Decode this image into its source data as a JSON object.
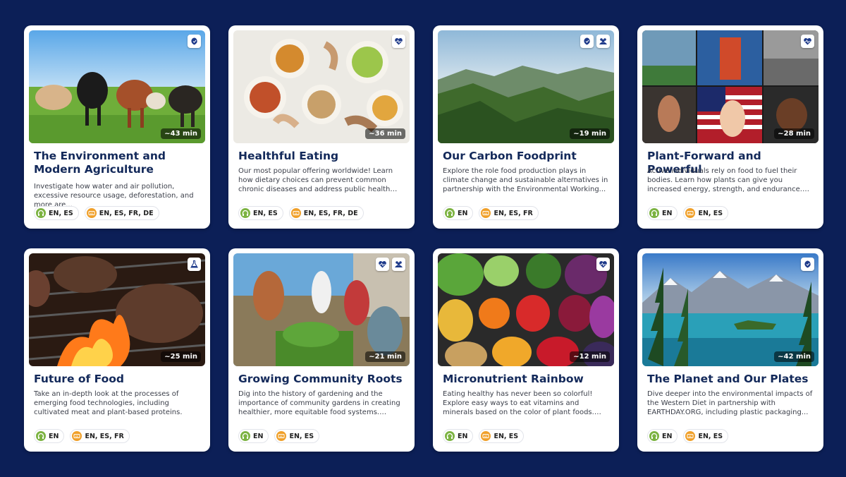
{
  "cards": [
    {
      "title": "The Environment and Modern Agriculture",
      "description": "Investigate how water and air pollution, excessive resource usage, deforestation, and more are...",
      "duration": "~43 min",
      "audio": "EN, ES",
      "cc": "EN, ES, FR, DE",
      "badges": [
        "leaf-heart-icon"
      ]
    },
    {
      "title": "Healthful Eating",
      "description": "Our most popular offering worldwide! Learn how dietary choices can prevent common chronic diseases and address public health concerns...",
      "duration": "~36 min",
      "audio": "EN, ES",
      "cc": "EN, ES, FR, DE",
      "badges": [
        "heart-pulse-icon"
      ]
    },
    {
      "title": "Our Carbon Foodprint",
      "description": "Explore the role food production plays in climate change and sustainable alternatives in partnership with the Environmental Working...",
      "duration": "~19 min",
      "audio": "EN",
      "cc": "EN, ES, FR",
      "badges": [
        "leaf-heart-icon",
        "community-icon"
      ]
    },
    {
      "title": "Plant-Forward and Powerful",
      "description": "Active individuals rely on food to fuel their bodies. Learn how plants can give you increased energy, strength, and endurance. These material...",
      "duration": "~28 min",
      "audio": "EN",
      "cc": "EN, ES",
      "badges": [
        "heart-pulse-icon"
      ]
    },
    {
      "title": "Future of Food",
      "description": "Take an in-depth look at the processes of emerging food technologies, including cultivated meat and plant-based proteins.",
      "duration": "~25 min",
      "audio": "EN",
      "cc": "EN, ES, FR",
      "badges": [
        "flask-icon"
      ]
    },
    {
      "title": "Growing Community Roots",
      "description": "Dig into the history of gardening and the importance of community gardens in creating healthier, more equitable food systems. These...",
      "duration": "~21 min",
      "audio": "EN",
      "cc": "EN, ES",
      "badges": [
        "heart-pulse-icon",
        "community-icon"
      ]
    },
    {
      "title": "Micronutrient Rainbow",
      "description": "Eating healthy has never been so colorful! Explore easy ways to eat vitamins and minerals based on the color of plant foods. These...",
      "duration": "~12 min",
      "audio": "EN",
      "cc": "EN, ES",
      "badges": [
        "heart-pulse-icon"
      ]
    },
    {
      "title": "The Planet and Our Plates",
      "description": "Dive deeper into the environmental impacts of the Western Diet in partnership with EARTHDAY.ORG, including plastic packaging...",
      "duration": "~42 min",
      "audio": "EN",
      "cc": "EN, ES",
      "badges": [
        "leaf-heart-icon"
      ]
    }
  ],
  "colors": {
    "background": "#0c1f57",
    "title": "#13295a",
    "audio_icon": "#7cb342",
    "cc_icon": "#f0a02a",
    "badge_icon": "#1e3a8a"
  }
}
